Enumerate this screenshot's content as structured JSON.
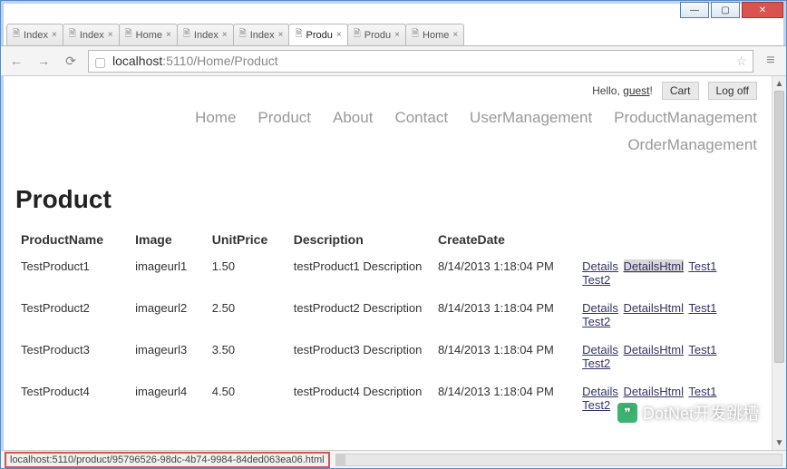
{
  "window": {
    "buttons": {
      "minimize": "—",
      "maximize": "▢",
      "close": "✕"
    }
  },
  "browser": {
    "tabs": [
      {
        "label": "Index",
        "active": false
      },
      {
        "label": "Index",
        "active": false
      },
      {
        "label": "Home",
        "active": false
      },
      {
        "label": "Index",
        "active": false
      },
      {
        "label": "Index",
        "active": false
      },
      {
        "label": "Produ",
        "active": true
      },
      {
        "label": "Produ",
        "active": false
      },
      {
        "label": "Home",
        "active": false
      }
    ],
    "url_host": "localhost",
    "url_path": ":5110/Home/Product",
    "nav": {
      "back": "←",
      "fwd": "→",
      "reload": "⟳",
      "star": "☆",
      "menu": "≡"
    }
  },
  "header": {
    "hello": "Hello, ",
    "user": "guest",
    "exclaim": "!",
    "cart": "Cart",
    "logoff": "Log off"
  },
  "nav": {
    "row1": [
      "Home",
      "Product",
      "About",
      "Contact",
      "UserManagement",
      "ProductManagement"
    ],
    "row2": [
      "OrderManagement"
    ]
  },
  "page": {
    "title": "Product"
  },
  "table": {
    "headers": [
      "ProductName",
      "Image",
      "UnitPrice",
      "Description",
      "CreateDate",
      ""
    ],
    "rows": [
      {
        "name": "TestProduct1",
        "image": "imageurl1",
        "price": "1.50",
        "desc": "testProduct1 Description",
        "date": "8/14/2013 1:18:04 PM"
      },
      {
        "name": "TestProduct2",
        "image": "imageurl2",
        "price": "2.50",
        "desc": "testProduct2 Description",
        "date": "8/14/2013 1:18:04 PM"
      },
      {
        "name": "TestProduct3",
        "image": "imageurl3",
        "price": "3.50",
        "desc": "testProduct3 Description",
        "date": "8/14/2013 1:18:04 PM"
      },
      {
        "name": "TestProduct4",
        "image": "imageurl4",
        "price": "4.50",
        "desc": "testProduct4 Description",
        "date": "8/14/2013 1:18:04 PM"
      }
    ],
    "actions": {
      "details": "Details",
      "detailsHtml": "DetailsHtml",
      "test1": "Test1",
      "test2": "Test2"
    }
  },
  "status": {
    "hint": "localhost:5110/product/95796526-98dc-4b74-9984-84ded063ea06.html"
  },
  "watermark": "DotNet开发跳槽"
}
